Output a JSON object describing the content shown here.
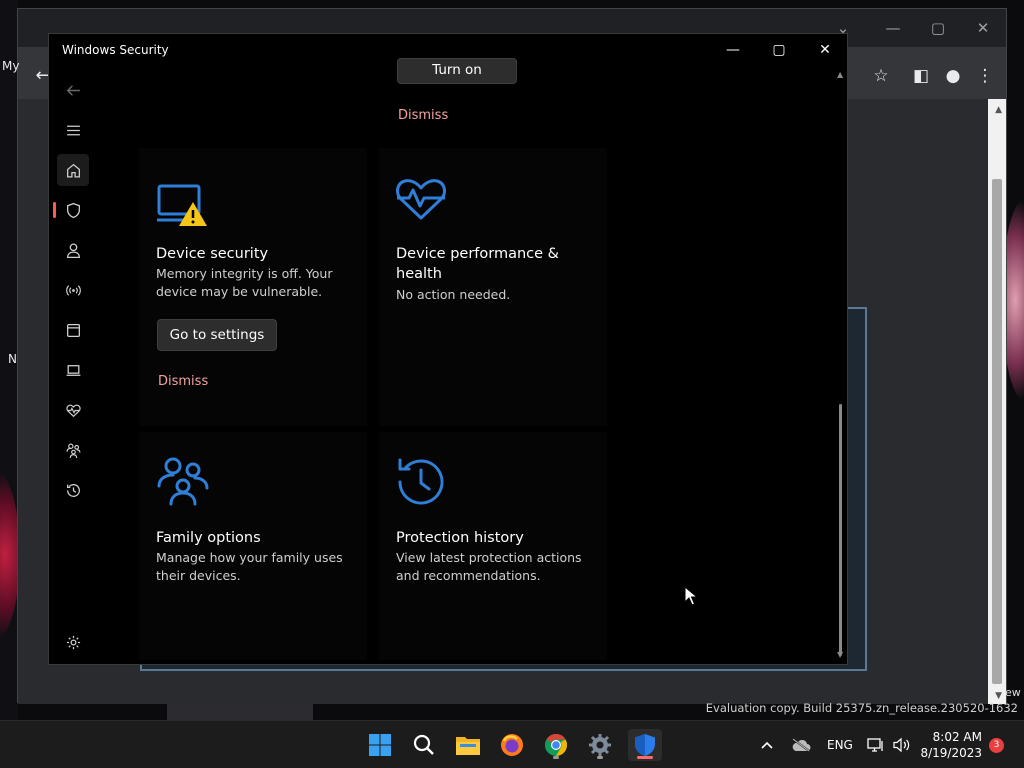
{
  "browser": {
    "left_fragment_top": "My",
    "left_fragment_mid": "N",
    "right_fragment": "ew"
  },
  "window": {
    "title": "Windows Security",
    "minimize": "—",
    "maximize": "▢",
    "close": "✕"
  },
  "nav": {
    "items": [
      {
        "name": "back",
        "icon": "back-arrow-icon"
      },
      {
        "name": "menu",
        "icon": "hamburger-icon"
      },
      {
        "name": "home",
        "icon": "home-icon"
      },
      {
        "name": "virus-protection",
        "icon": "shield-icon"
      },
      {
        "name": "account-protection",
        "icon": "person-icon"
      },
      {
        "name": "firewall",
        "icon": "antenna-icon"
      },
      {
        "name": "app-browser",
        "icon": "app-window-icon"
      },
      {
        "name": "device-security",
        "icon": "laptop-icon"
      },
      {
        "name": "device-performance",
        "icon": "heartbeat-icon"
      },
      {
        "name": "family",
        "icon": "family-icon"
      },
      {
        "name": "history",
        "icon": "history-icon"
      },
      {
        "name": "settings",
        "icon": "gear-icon"
      }
    ]
  },
  "top_partial": {
    "turn_on_label": "Turn on",
    "dismiss_label": "Dismiss"
  },
  "tiles": {
    "device_security": {
      "title": "Device security",
      "desc_line1": "Memory integrity is off. Your",
      "desc_line2": "device may be vulnerable.",
      "button": "Go to settings",
      "dismiss": "Dismiss"
    },
    "device_performance": {
      "title_line1": "Device performance &",
      "title_line2": "health",
      "desc": "No action needed."
    },
    "family": {
      "title": "Family options",
      "desc_line1": "Manage how your family uses",
      "desc_line2": "their devices."
    },
    "history": {
      "title": "Protection history",
      "desc_line1": "View latest protection actions",
      "desc_line2": "and recommendations."
    }
  },
  "colors": {
    "accent_icon": "#2f7ed8",
    "dismiss": "#f4a2a0",
    "warning": "#f5c518"
  },
  "watermark": "Evaluation copy. Build 25375.zn_release.230520-1632",
  "taskbar": {
    "apps": [
      "start-icon",
      "search-icon",
      "file-explorer-icon",
      "firefox-icon",
      "chrome-icon",
      "settings-icon",
      "windows-security-icon"
    ],
    "language": "ENG",
    "time": "8:02 AM",
    "date": "8/19/2023",
    "notification_count": "3"
  }
}
